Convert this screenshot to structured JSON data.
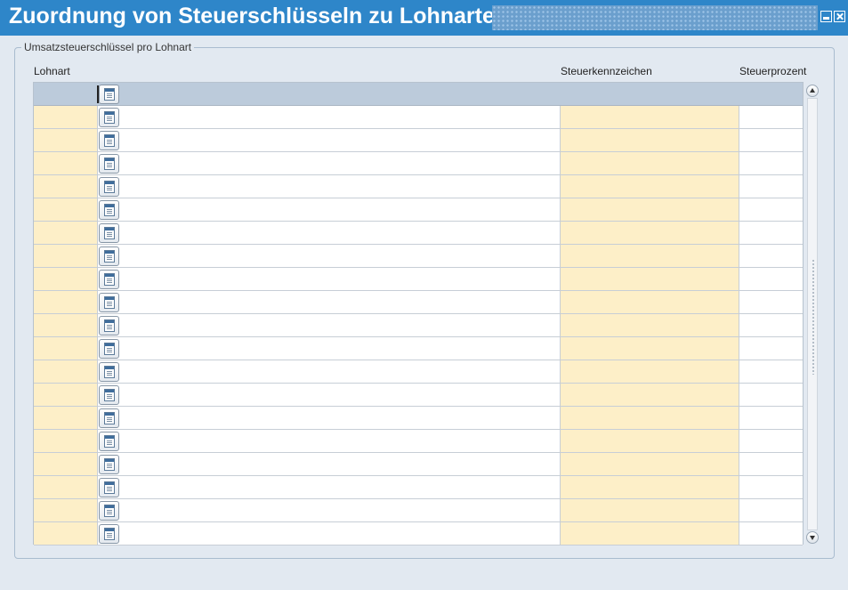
{
  "window": {
    "title": "Zuordnung von Steuerschlüsseln zu Lohnarten"
  },
  "group": {
    "legend": "Umsatzsteuerschlüssel pro Lohnart"
  },
  "columns": {
    "lohnart": "Lohnart",
    "steuerkennzeichen": "Steuerkennzeichen",
    "steuerprozent": "Steuerprozent"
  },
  "rows": [
    {
      "lohnart": "",
      "bezeichnung": "",
      "steuerkennzeichen": "",
      "steuerprozent": ""
    },
    {
      "lohnart": "",
      "bezeichnung": "",
      "steuerkennzeichen": "",
      "steuerprozent": ""
    },
    {
      "lohnart": "",
      "bezeichnung": "",
      "steuerkennzeichen": "",
      "steuerprozent": ""
    },
    {
      "lohnart": "",
      "bezeichnung": "",
      "steuerkennzeichen": "",
      "steuerprozent": ""
    },
    {
      "lohnart": "",
      "bezeichnung": "",
      "steuerkennzeichen": "",
      "steuerprozent": ""
    },
    {
      "lohnart": "",
      "bezeichnung": "",
      "steuerkennzeichen": "",
      "steuerprozent": ""
    },
    {
      "lohnart": "",
      "bezeichnung": "",
      "steuerkennzeichen": "",
      "steuerprozent": ""
    },
    {
      "lohnart": "",
      "bezeichnung": "",
      "steuerkennzeichen": "",
      "steuerprozent": ""
    },
    {
      "lohnart": "",
      "bezeichnung": "",
      "steuerkennzeichen": "",
      "steuerprozent": ""
    },
    {
      "lohnart": "",
      "bezeichnung": "",
      "steuerkennzeichen": "",
      "steuerprozent": ""
    },
    {
      "lohnart": "",
      "bezeichnung": "",
      "steuerkennzeichen": "",
      "steuerprozent": ""
    },
    {
      "lohnart": "",
      "bezeichnung": "",
      "steuerkennzeichen": "",
      "steuerprozent": ""
    },
    {
      "lohnart": "",
      "bezeichnung": "",
      "steuerkennzeichen": "",
      "steuerprozent": ""
    },
    {
      "lohnart": "",
      "bezeichnung": "",
      "steuerkennzeichen": "",
      "steuerprozent": ""
    },
    {
      "lohnart": "",
      "bezeichnung": "",
      "steuerkennzeichen": "",
      "steuerprozent": ""
    },
    {
      "lohnart": "",
      "bezeichnung": "",
      "steuerkennzeichen": "",
      "steuerprozent": ""
    },
    {
      "lohnart": "",
      "bezeichnung": "",
      "steuerkennzeichen": "",
      "steuerprozent": ""
    },
    {
      "lohnart": "",
      "bezeichnung": "",
      "steuerkennzeichen": "",
      "steuerprozent": ""
    },
    {
      "lohnart": "",
      "bezeichnung": "",
      "steuerkennzeichen": "",
      "steuerprozent": ""
    },
    {
      "lohnart": "",
      "bezeichnung": "",
      "steuerkennzeichen": "",
      "steuerprozent": ""
    }
  ],
  "icons": {
    "lov": "list-of-values-icon",
    "minimize": "minimize-icon",
    "close": "close-icon",
    "scroll_up": "scroll-up-icon",
    "scroll_down": "scroll-down-icon"
  },
  "colors": {
    "titlebar": "#2e86c9",
    "required_field": "#fdefc8",
    "header_row": "#bccbdb",
    "background": "#e2e9f1"
  }
}
